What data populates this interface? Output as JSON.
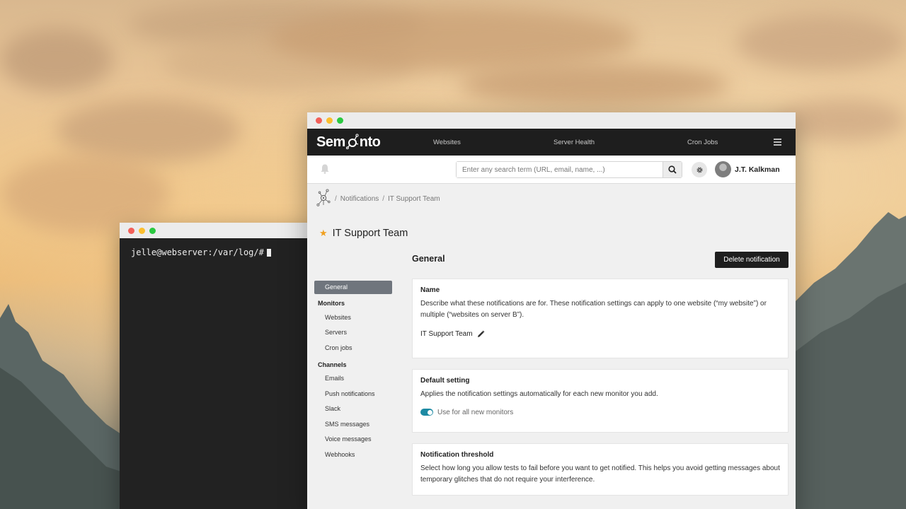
{
  "terminal": {
    "prompt": "jelle@webserver:/var/log/#"
  },
  "browser": {
    "logo_text_left": "Sem",
    "logo_text_right": "nto",
    "nav": {
      "websites": "Websites",
      "server_health": "Server Health",
      "cron_jobs": "Cron Jobs"
    },
    "search": {
      "placeholder": "Enter any search term (URL, email, name, ...)"
    },
    "user": {
      "name": "J.T. Kalkman"
    },
    "breadcrumb": {
      "separator": "/",
      "items": [
        "Notifications",
        "IT Support Team"
      ]
    },
    "page_title": "IT Support Team",
    "section_title": "General",
    "delete_button": "Delete notification",
    "sidenav": {
      "active": "General",
      "monitors_heading": "Monitors",
      "monitors": [
        "Websites",
        "Servers",
        "Cron jobs"
      ],
      "channels_heading": "Channels",
      "channels": [
        "Emails",
        "Push notifications",
        "Slack",
        "SMS messages",
        "Voice messages",
        "Webhooks"
      ]
    },
    "cards": {
      "name": {
        "title": "Name",
        "description": "Describe what these notifications are for. These notification settings can apply to one website (“my website”) or multiple (“websites on server B”).",
        "value": "IT Support Team"
      },
      "default_setting": {
        "title": "Default setting",
        "description": "Applies the notification settings automatically for each new monitor you add.",
        "toggle_label": "Use for all new monitors",
        "toggle_on": true
      },
      "threshold": {
        "title": "Notification threshold",
        "description": "Select how long you allow tests to fail before you want to get notified. This helps you avoid getting messages about temporary glitches that do not require your interference."
      }
    },
    "colors": {
      "accent": "#1d8aa3",
      "star": "#f0a020",
      "topbar": "#1e1e1e"
    }
  }
}
